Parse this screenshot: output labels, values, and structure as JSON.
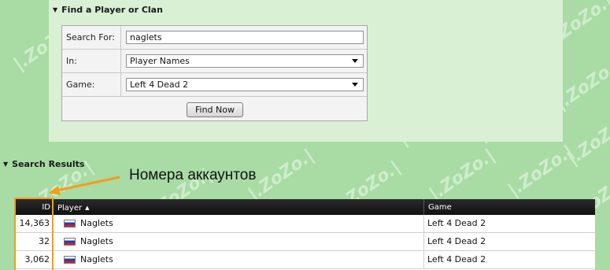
{
  "find_panel": {
    "title": "Find a Player or Clan",
    "search_for_label": "Search For:",
    "search_value": "naglets",
    "in_label": "In:",
    "in_selected": "Player Names",
    "game_label": "Game:",
    "game_selected": "Left 4 Dead 2",
    "find_button": "Find Now"
  },
  "results": {
    "title": "Search Results",
    "columns": {
      "id": "ID",
      "player": "Player",
      "game": "Game"
    },
    "rows": [
      {
        "id": "14,363",
        "player": "Naglets",
        "game": "Left 4 Dead 2"
      },
      {
        "id": "32",
        "player": "Naglets",
        "game": "Left 4 Dead 2"
      },
      {
        "id": "3,062",
        "player": "Naglets",
        "game": "Left 4 Dead 2"
      }
    ]
  },
  "annotation": {
    "text": "Номера аккаунтов",
    "color": "#f59c1a"
  },
  "watermark": "|.ZoZo.|",
  "colors": {
    "background": "#a8dca4",
    "panel": "#d9f0d5",
    "header": "#1a1a1a",
    "accent": "#f59c1a"
  }
}
